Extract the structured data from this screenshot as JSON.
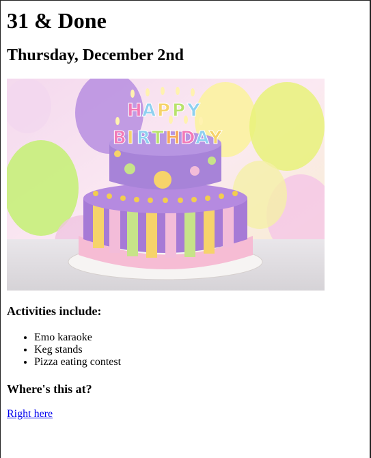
{
  "page": {
    "title": "31 & Done",
    "date": "Thursday, December 2nd"
  },
  "image": {
    "description_icon": "birthday-cake-image",
    "cake_text": "HAPPY BIRTHDAY"
  },
  "activities": {
    "heading": "Activities include:",
    "items": [
      "Emo karaoke",
      "Keg stands",
      "Pizza eating contest"
    ]
  },
  "location": {
    "heading": "Where's this at?",
    "link_label": "Right here"
  },
  "colors": {
    "link": "#0000ee"
  }
}
